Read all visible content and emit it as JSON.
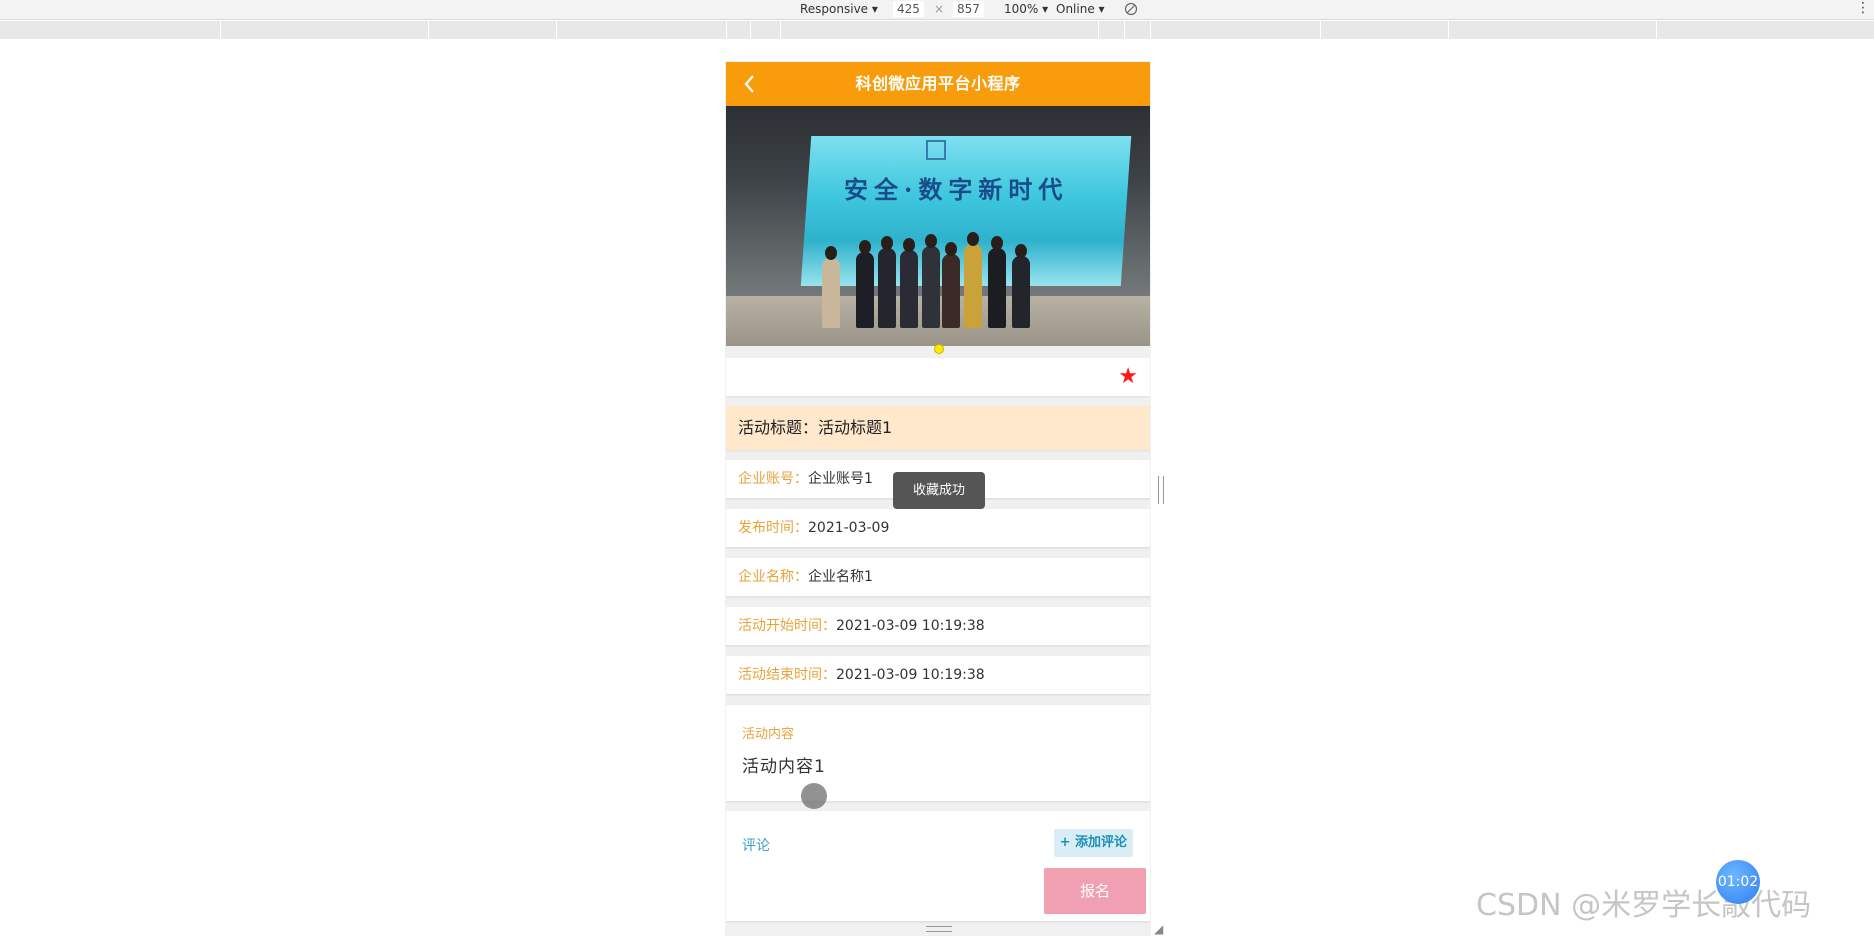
{
  "devtools": {
    "device": "Responsive",
    "width": "425",
    "times": "×",
    "height": "857",
    "zoom": "100%",
    "network": "Online",
    "dropdown_glyph": "▾"
  },
  "app": {
    "nav_title": "科创微应用平台小程序",
    "back_icon": "chevron-left-icon"
  },
  "banner": {
    "screen_text": "安全·数字新时代",
    "active_slide": 1
  },
  "favorite": {
    "star_glyph": "★",
    "star_color": "#ff1a1a"
  },
  "activity": {
    "title_label": "活动标题：",
    "title_value": "活动标题1",
    "fields": [
      {
        "label": "企业账号：",
        "value": "企业账号1"
      },
      {
        "label": "发布时间：",
        "value": "2021-03-09"
      },
      {
        "label": "企业名称：",
        "value": "企业名称1"
      },
      {
        "label": "活动开始时间：",
        "value": "2021-03-09 10:19:38"
      },
      {
        "label": "活动结束时间：",
        "value": "2021-03-09 10:19:38"
      }
    ],
    "content_label": "活动内容",
    "content_value": "活动内容1"
  },
  "comments": {
    "label": "评论",
    "add_button": "+ 添加评论"
  },
  "toast": "收藏成功",
  "signup_button": "报名",
  "timer": "01:02",
  "watermark": "CSDN @米罗学长敲代码",
  "colors": {
    "nav": "#f99c0b",
    "label": "#e8a33a",
    "title_bg": "#ffe8cc",
    "signup_bg": "#f0a0b0"
  }
}
